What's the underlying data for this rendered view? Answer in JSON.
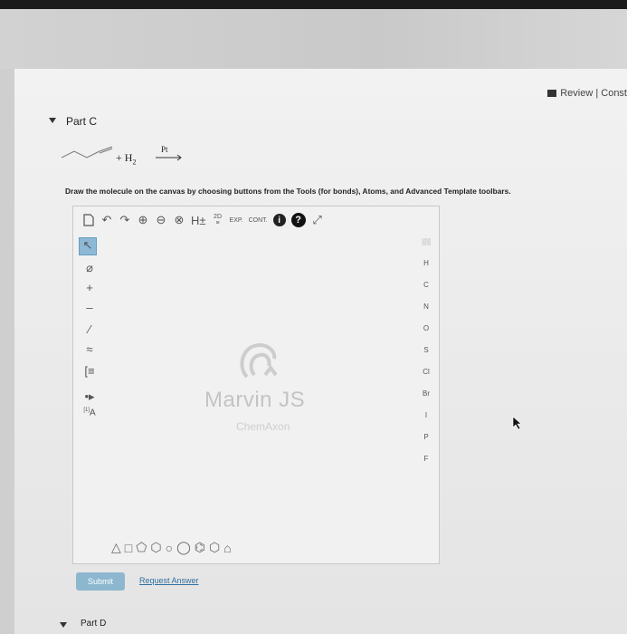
{
  "header": {
    "review_label": "Review | Const"
  },
  "part_c": {
    "title": "Part C",
    "reaction": {
      "reagent": "+ H",
      "reagent_sub": "2",
      "catalyst": "Pt"
    },
    "instruction": "Draw the molecule on the canvas by choosing buttons from the Tools (for bonds), Atoms, and Advanced Template toolbars."
  },
  "toolbar": {
    "h_label": "H±",
    "two_d": "2D",
    "exp": "EXP.",
    "cont": "CONT.",
    "info": "i",
    "help": "?"
  },
  "left_tools": {
    "plus": "+",
    "minus": "–",
    "charge_label": "[1]",
    "text_tool": "A"
  },
  "watermark": {
    "product": "Marvin JS",
    "company": "ChemAxon"
  },
  "atoms": [
    "H",
    "C",
    "N",
    "O",
    "S",
    "Cl",
    "Br",
    "I",
    "P",
    "F"
  ],
  "actions": {
    "submit": "Submit",
    "request_answer": "Request Answer"
  },
  "part_d": {
    "title": "Part D"
  },
  "colors": {
    "submit": "#8cb7cf",
    "link": "#2f6fa0",
    "selected_tool": "#8db8d6"
  }
}
